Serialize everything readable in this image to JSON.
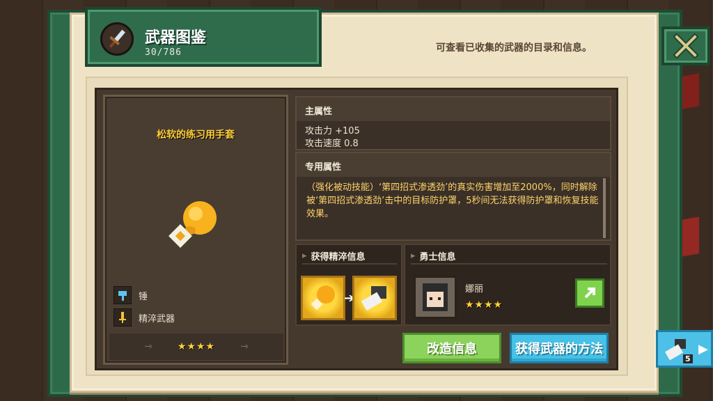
{
  "header": {
    "title": "武器图鉴",
    "count": "30/786",
    "description": "可查看已收集的武器的目录和信息。"
  },
  "weapon": {
    "name": "松软的练习用手套",
    "attributes": [
      {
        "icon": "hammer-type-icon",
        "label": "锤"
      },
      {
        "icon": "refine-weapon-icon",
        "label": "精淬武器"
      }
    ],
    "stars": "★★★★"
  },
  "main_stats": {
    "heading": "主属性",
    "lines": [
      "攻击力 +105",
      "攻击速度 0.8"
    ]
  },
  "exclusive": {
    "heading": "专用属性",
    "text": "（强化被动技能）‘第四招式渗透劲’的真实伤害增加至2000%，同时解除被‘第四招式渗透劲’击中的目标防护罩，5秒间无法获得防护罩和恢复技能效果。"
  },
  "refine_info": {
    "heading": "获得精淬信息"
  },
  "hero_info": {
    "heading": "勇士信息",
    "name": "娜丽",
    "stars": "★★★★"
  },
  "buttons": {
    "modify": "改造信息",
    "obtain": "获得武器的方法"
  },
  "side_tab": {
    "count": "5"
  },
  "colors": {
    "book_green": "#2e6a4a",
    "parchment": "#efe3c6",
    "weapon_name_gold": "#ffcf3a",
    "star_gold": "#ffd23a",
    "button_green": "#8bd35a",
    "button_blue": "#46c1e8"
  }
}
